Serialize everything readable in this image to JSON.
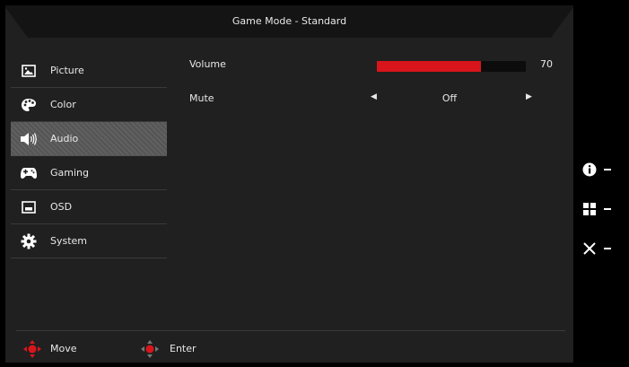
{
  "header": {
    "title": "Game Mode - Standard"
  },
  "sidebar": {
    "items": [
      {
        "label": "Picture",
        "icon": "picture-icon",
        "active": false
      },
      {
        "label": "Color",
        "icon": "palette-icon",
        "active": false
      },
      {
        "label": "Audio",
        "icon": "speaker-icon",
        "active": true
      },
      {
        "label": "Gaming",
        "icon": "gamepad-icon",
        "active": false
      },
      {
        "label": "OSD",
        "icon": "osd-window-icon",
        "active": false
      },
      {
        "label": "System",
        "icon": "gear-icon",
        "active": false
      }
    ]
  },
  "settings": {
    "volume": {
      "label": "Volume",
      "value": 70,
      "display": "70"
    },
    "mute": {
      "label": "Mute",
      "value": "Off"
    }
  },
  "footer": {
    "move_label": "Move",
    "enter_label": "Enter"
  },
  "right_keys": [
    {
      "icon": "info-icon"
    },
    {
      "icon": "menu-grid-icon"
    },
    {
      "icon": "close-icon"
    }
  ],
  "colors": {
    "accent": "#d8151b",
    "panel": "#202020",
    "active_item": "#5a5a5a"
  }
}
